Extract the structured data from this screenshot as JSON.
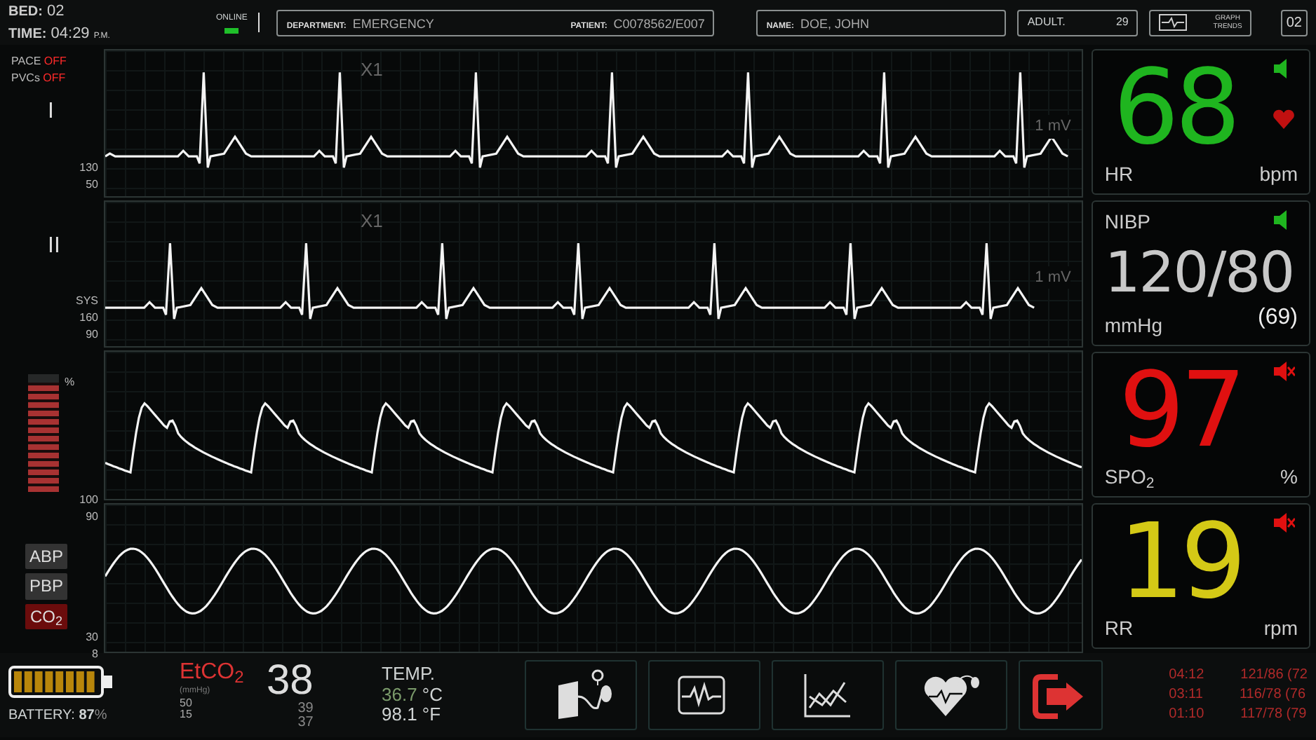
{
  "header": {
    "bed": {
      "label": "BED:",
      "value": "02"
    },
    "time": {
      "label": "TIME:",
      "value": "04:29",
      "suffix": "P.M."
    },
    "online": {
      "label": "ONLINE",
      "on": true
    },
    "department": {
      "label": "DEPARTMENT:",
      "value": "EMERGENCY"
    },
    "patient": {
      "label": "PATIENT:",
      "value": "C0078562/E007"
    },
    "name": {
      "label": "NAME:",
      "value": "DOE, JOHN"
    },
    "category": {
      "label": "ADULT.",
      "value": "29"
    },
    "trends_button": {
      "label_1": "GRAPH",
      "label_2": "TRENDS"
    },
    "screen": "02"
  },
  "status": [
    {
      "label": "PACE",
      "value": "OFF"
    },
    {
      "label": "PVCs",
      "value": "OFF"
    }
  ],
  "waves": [
    {
      "kind": "ecg",
      "lead": "I",
      "gain": "X1",
      "calibration": "1 mV",
      "scale": [
        "130",
        "50"
      ]
    },
    {
      "kind": "ecg2",
      "lead": "II",
      "gain": "X1",
      "calibration": "1 mV",
      "scale": [
        "SYS",
        "160",
        "90"
      ]
    },
    {
      "kind": "pleth",
      "unit": "%",
      "meter": {
        "level": 0.93
      },
      "scale": [
        "100",
        "90"
      ]
    },
    {
      "kind": "co2",
      "modes": [
        {
          "label": "ABP",
          "selected": false
        },
        {
          "label": "PBP",
          "selected": false
        },
        {
          "label": "CO$_{2}$",
          "selected": true
        }
      ],
      "scale": [
        "30",
        "8"
      ]
    }
  ],
  "tiles": [
    {
      "kind": "hr",
      "value": "68",
      "label": "HR",
      "unit": "bpm",
      "color": "#1fb51f",
      "muted": false,
      "heart": true
    },
    {
      "kind": "nibp",
      "title": "NIBP",
      "value": "120/80",
      "mean": "(69)",
      "label": "mmHg",
      "color": "#c8c8c8",
      "muted": false
    },
    {
      "kind": "spo2",
      "value": "97",
      "label": "SPO$_{2}$",
      "unit": "%",
      "color": "#e01010",
      "muted": true
    },
    {
      "kind": "rr",
      "value": "19",
      "label": "RR",
      "unit": "rpm",
      "color": "#d4c916",
      "muted": true
    }
  ],
  "footer": {
    "battery": {
      "label": "BATTERY:",
      "value": "87",
      "unit": "%"
    },
    "etco2": {
      "label": "EtCO$_{2}$",
      "unit": "(mmHg)",
      "value": "38",
      "limits": [
        "50",
        "15"
      ],
      "readings": [
        "39",
        "37"
      ]
    },
    "temp": {
      "label": "TEMP.",
      "celsius": "36.7",
      "celsius_unit": "°C",
      "fahrenheit": "98.1 °F"
    },
    "buttons": [
      {
        "kind": "cuff"
      },
      {
        "kind": "ecg"
      },
      {
        "kind": "chart"
      },
      {
        "kind": "heart"
      },
      {
        "kind": "exit"
      }
    ],
    "history": [
      {
        "time": "04:12",
        "bp": "121/86 (72"
      },
      {
        "time": "03:11",
        "bp": "116/78 (76"
      },
      {
        "time": "01:10",
        "bp": "117/78 (79"
      }
    ]
  }
}
